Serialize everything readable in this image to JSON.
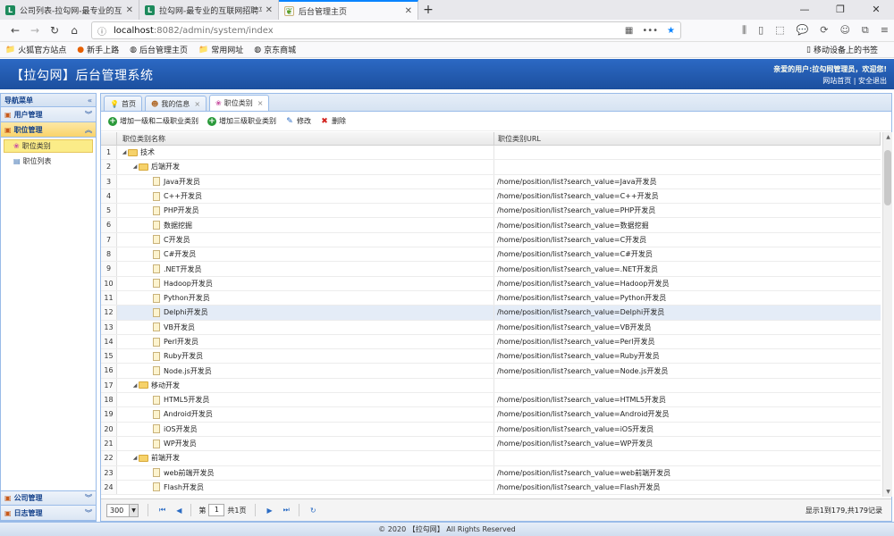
{
  "browser": {
    "tabs": [
      {
        "title": "公司列表-拉勾网-最专业的互联",
        "favicon": "L",
        "active": false
      },
      {
        "title": "拉勾网-最专业的互联网招聘平",
        "favicon": "L",
        "active": false
      },
      {
        "title": "后台管理主页",
        "favicon": "leaf",
        "active": true
      }
    ],
    "url_host": "localhost",
    "url_path": ":8082/admin/system/index",
    "bookmarks": [
      "火狐官方站点",
      "新手上路",
      "后台管理主页",
      "常用网址",
      "京东商城"
    ],
    "mobile_bookmarks": "移动设备上的书签"
  },
  "header": {
    "title": "【拉勾网】后台管理系统",
    "welcome": "亲爱的用户:拉勾网管理员，欢迎您!",
    "home_link": "网站首页",
    "logout_link": "安全退出"
  },
  "sidebar": {
    "title": "导航菜单",
    "accordions": [
      {
        "label": "用户管理"
      },
      {
        "label": "职位管理",
        "items": [
          "职位类别",
          "职位列表"
        ]
      }
    ],
    "bottom_accordions": [
      {
        "label": "公司管理"
      },
      {
        "label": "日志管理"
      }
    ]
  },
  "main": {
    "tabs": [
      {
        "label": "首页",
        "closable": false
      },
      {
        "label": "我的信息",
        "closable": true
      },
      {
        "label": "职位类别",
        "closable": true,
        "active": true
      }
    ],
    "toolbar": {
      "add_level12": "增加一级和二级职业类别",
      "add_level3": "增加三级职业类别",
      "edit": "修改",
      "delete": "删除"
    },
    "grid": {
      "columns": [
        "职位类别名称",
        "职位类别URL"
      ],
      "rows": [
        {
          "n": "1",
          "name": "技术",
          "url": "",
          "level": 0,
          "folder": true
        },
        {
          "n": "2",
          "name": "后端开发",
          "url": "",
          "level": 1,
          "folder": true
        },
        {
          "n": "3",
          "name": "Java开发员",
          "url": "/home/position/list?search_value=Java开发员",
          "level": 2
        },
        {
          "n": "4",
          "name": "C++开发员",
          "url": "/home/position/list?search_value=C++开发员",
          "level": 2
        },
        {
          "n": "5",
          "name": "PHP开发员",
          "url": "/home/position/list?search_value=PHP开发员",
          "level": 2
        },
        {
          "n": "6",
          "name": "数据挖掘",
          "url": "/home/position/list?search_value=数据挖掘",
          "level": 2
        },
        {
          "n": "7",
          "name": "C开发员",
          "url": "/home/position/list?search_value=C开发员",
          "level": 2
        },
        {
          "n": "8",
          "name": "C#开发员",
          "url": "/home/position/list?search_value=C#开发员",
          "level": 2
        },
        {
          "n": "9",
          "name": ".NET开发员",
          "url": "/home/position/list?search_value=.NET开发员",
          "level": 2
        },
        {
          "n": "10",
          "name": "Hadoop开发员",
          "url": "/home/position/list?search_value=Hadoop开发员",
          "level": 2
        },
        {
          "n": "11",
          "name": "Python开发员",
          "url": "/home/position/list?search_value=Python开发员",
          "level": 2
        },
        {
          "n": "12",
          "name": "Delphi开发员",
          "url": "/home/position/list?search_value=Delphi开发员",
          "level": 2,
          "selected": true
        },
        {
          "n": "13",
          "name": "VB开发员",
          "url": "/home/position/list?search_value=VB开发员",
          "level": 2
        },
        {
          "n": "14",
          "name": "Perl开发员",
          "url": "/home/position/list?search_value=Perl开发员",
          "level": 2
        },
        {
          "n": "15",
          "name": "Ruby开发员",
          "url": "/home/position/list?search_value=Ruby开发员",
          "level": 2
        },
        {
          "n": "16",
          "name": "Node.js开发员",
          "url": "/home/position/list?search_value=Node.js开发员",
          "level": 2
        },
        {
          "n": "17",
          "name": "移动开发",
          "url": "",
          "level": 1,
          "folder": true
        },
        {
          "n": "18",
          "name": "HTML5开发员",
          "url": "/home/position/list?search_value=HTML5开发员",
          "level": 2
        },
        {
          "n": "19",
          "name": "Android开发员",
          "url": "/home/position/list?search_value=Android开发员",
          "level": 2
        },
        {
          "n": "20",
          "name": "iOS开发员",
          "url": "/home/position/list?search_value=iOS开发员",
          "level": 2
        },
        {
          "n": "21",
          "name": "WP开发员",
          "url": "/home/position/list?search_value=WP开发员",
          "level": 2
        },
        {
          "n": "22",
          "name": "前端开发",
          "url": "",
          "level": 1,
          "folder": true
        },
        {
          "n": "23",
          "name": "web前端开发员",
          "url": "/home/position/list?search_value=web前端开发员",
          "level": 2
        },
        {
          "n": "24",
          "name": "Flash开发员",
          "url": "/home/position/list?search_value=Flash开发员",
          "level": 2
        }
      ]
    },
    "pager": {
      "page_size": "300",
      "page_label_pre": "第",
      "page_value": "1",
      "page_label_post": "共1页",
      "info": "显示1到179,共179记录"
    }
  },
  "footer": {
    "text": "© 2020 【拉勾网】 All Rights Reserved"
  }
}
